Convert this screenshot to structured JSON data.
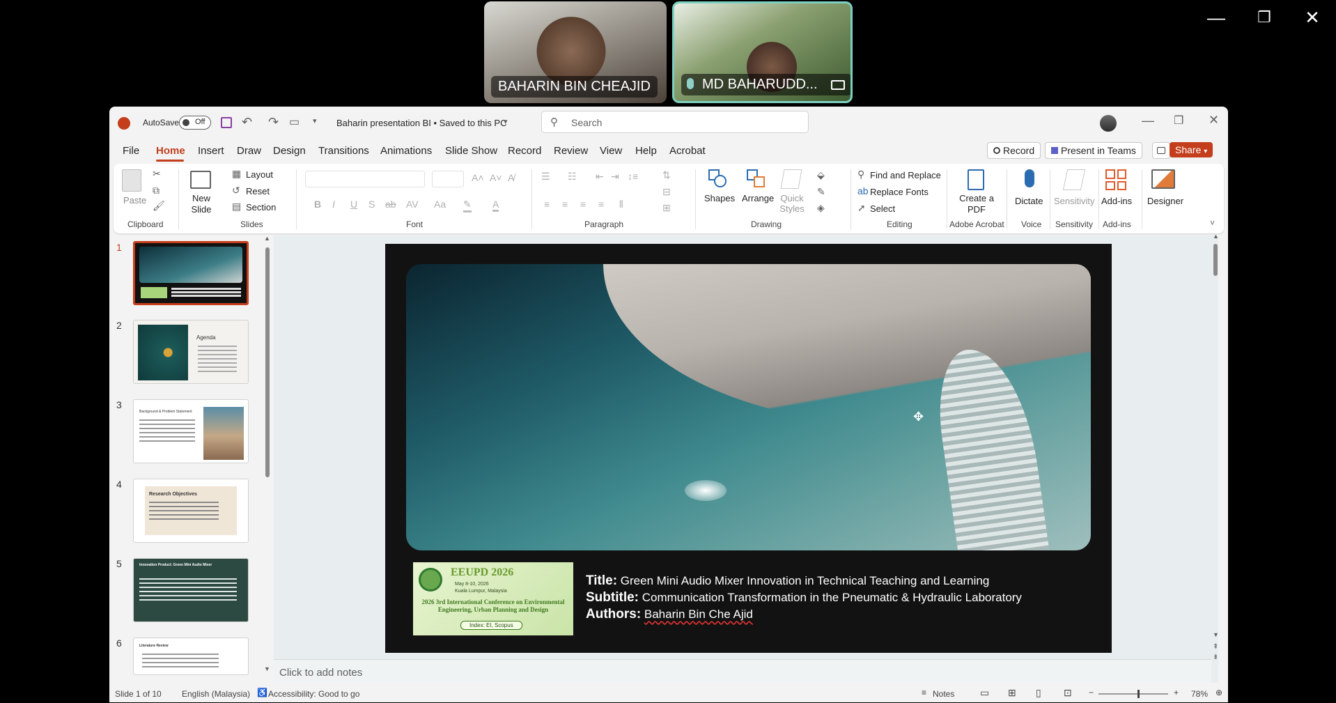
{
  "teams": {
    "participants": [
      {
        "name": "BAHARIN BIN CHEAJID"
      },
      {
        "name": "MD BAHARUDD..."
      }
    ],
    "window_controls": {
      "minimize": "—",
      "restore": "❐",
      "close": "✕"
    }
  },
  "titlebar": {
    "autosave_label": "AutoSave",
    "autosave_state": "Off",
    "doc_title": "Baharin presentation BI  •  Saved to this PC",
    "search_placeholder": "Search"
  },
  "menu": [
    "File",
    "Home",
    "Insert",
    "Draw",
    "Design",
    "Transitions",
    "Animations",
    "Slide Show",
    "Record",
    "Review",
    "View",
    "Help",
    "Acrobat"
  ],
  "menu_active": "Home",
  "top_actions": {
    "record": "Record",
    "present_in_teams": "Present in Teams",
    "share": "Share"
  },
  "ribbon": {
    "paste": "Paste",
    "new_slide": "New Slide",
    "layout": "Layout",
    "reset": "Reset",
    "section": "Section",
    "shapes": "Shapes",
    "arrange": "Arrange",
    "quick_styles": "Quick Styles",
    "find_replace": "Find and Replace",
    "replace_fonts": "Replace Fonts",
    "select": "Select",
    "create_pdf": "Create a PDF",
    "dictate": "Dictate",
    "sensitivity": "Sensitivity",
    "add_ins": "Add-ins",
    "designer": "Designer",
    "groups": {
      "clipboard": "Clipboard",
      "slides": "Slides",
      "font": "Font",
      "paragraph": "Paragraph",
      "drawing": "Drawing",
      "editing": "Editing",
      "adobe": "Adobe Acrobat",
      "voice": "Voice",
      "sensitivity": "Sensitivity",
      "addins": "Add-ins"
    }
  },
  "thumbnails": [
    {
      "num": "1",
      "title": ""
    },
    {
      "num": "2",
      "title": "Agenda"
    },
    {
      "num": "3",
      "title": "Background & Problem Statement"
    },
    {
      "num": "4",
      "title": "Research Objectives"
    },
    {
      "num": "5",
      "title": "Innovation Product: Green Mini Audio Mixer"
    },
    {
      "num": "6",
      "title": "Literature Review"
    }
  ],
  "slide": {
    "conference_logo_text": "EEUPD 2026",
    "conference_date": "May 8-10, 2026",
    "conference_place": "Kuala Lumpur, Malaysia",
    "conference_name": "2026 3rd International Conference on Environmental Engineering, Urban Planning and Design",
    "conference_index": "Index: EI, Scopus",
    "title_label": "Title:",
    "title_value": "Green Mini Audio Mixer Innovation in Technical Teaching and Learning",
    "subtitle_label": "Subtitle:",
    "subtitle_value": "Communication Transformation in the Pneumatic & Hydraulic Laboratory",
    "authors_label": "Authors:",
    "authors_value": "Baharin Bin Che Ajid"
  },
  "notes_placeholder": "Click to add notes",
  "status": {
    "slide_count": "Slide 1 of 10",
    "language": "English (Malaysia)",
    "accessibility": "Accessibility: Good to go",
    "notes": "Notes",
    "zoom": "78%"
  }
}
